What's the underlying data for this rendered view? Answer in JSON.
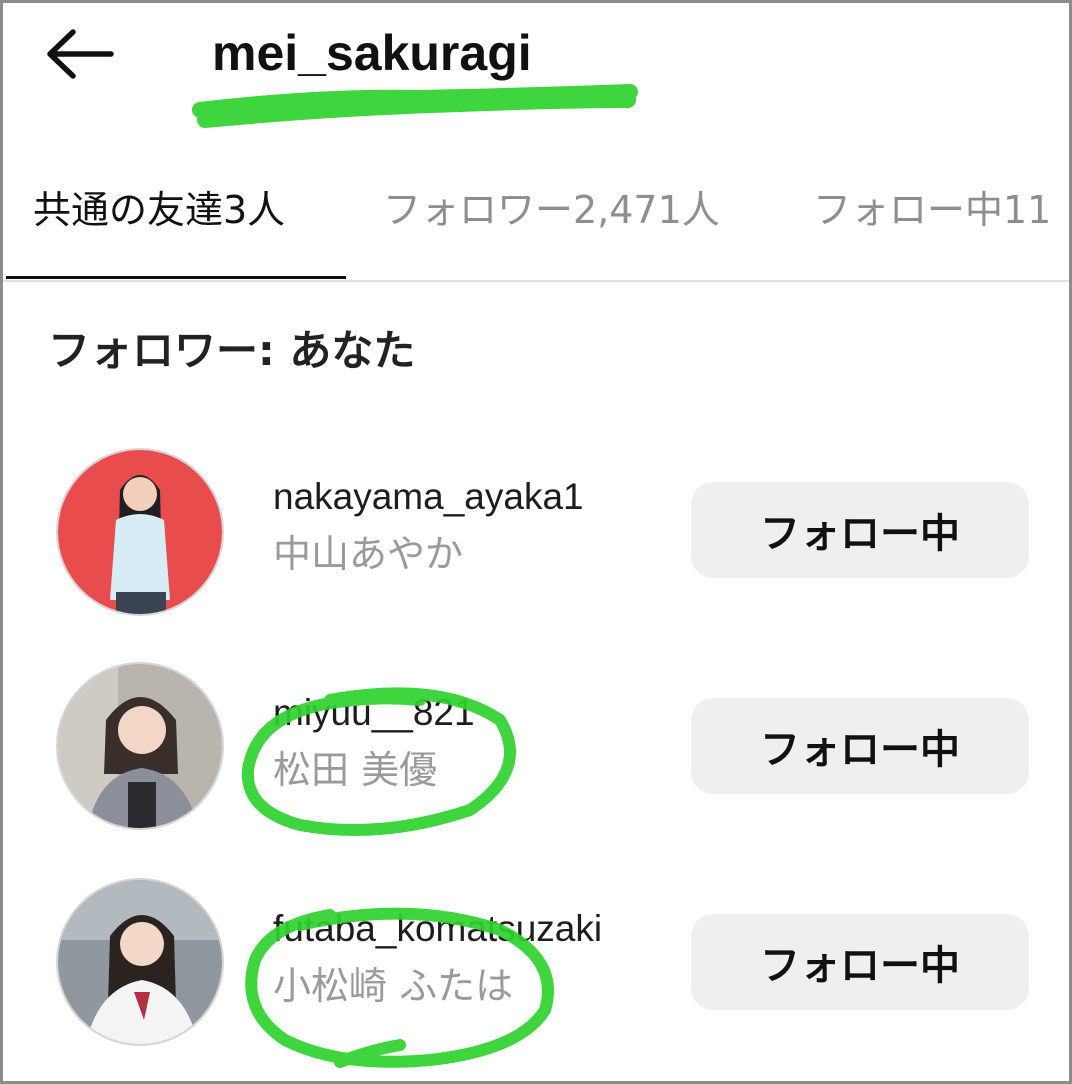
{
  "header": {
    "back_icon": "arrow-left-icon",
    "title": "mei_sakuragi"
  },
  "tabs": [
    {
      "label": "共通の友達3人",
      "active": true
    },
    {
      "label": "フォロワー2,471人",
      "active": false
    },
    {
      "label": "フォロー中11",
      "active": false
    }
  ],
  "section": {
    "title": "フォロワー: あなた"
  },
  "users": [
    {
      "username": "nakayama_ayaka1",
      "fullname": "中山あやか",
      "button_label": "フォロー中",
      "avatar_bg": "#e84c4c"
    },
    {
      "username": "miyuu__821",
      "fullname": "松田 美優",
      "button_label": "フォロー中",
      "avatar_bg": "#b9b4ae"
    },
    {
      "username": "futaba_komatsuzaki",
      "fullname": "小松崎 ふたは",
      "button_label": "フォロー中",
      "avatar_bg": "#8f979f"
    }
  ],
  "colors": {
    "highlight": "#2fd12f",
    "button_bg": "#efefef",
    "secondary_text": "#9a9a9a"
  }
}
